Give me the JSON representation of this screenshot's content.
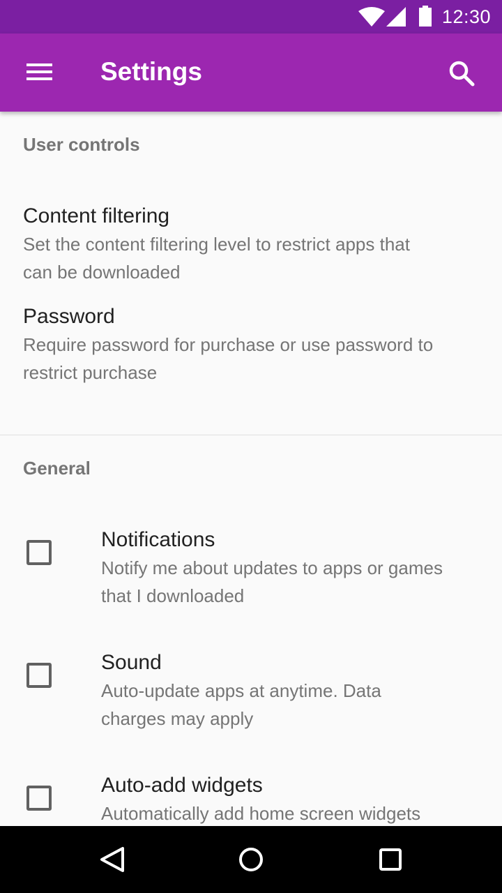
{
  "status_bar": {
    "time": "12:30",
    "icons": [
      "wifi-icon",
      "cellular-signal-icon",
      "battery-icon"
    ]
  },
  "app_bar": {
    "title": "Settings",
    "menu_icon": "menu-icon",
    "search_icon": "search-icon",
    "color": "#9c27b0",
    "status_color": "#7b1fa2"
  },
  "sections": {
    "user_controls": {
      "header": "User controls",
      "items": [
        {
          "title": "Content filtering",
          "desc_line1": "Set the content filtering level to restrict apps that",
          "desc_line2": "can be downloaded"
        },
        {
          "title": "Password",
          "desc_line1": "Require password for purchase or use password to",
          "desc_line2": "restrict purchase"
        }
      ]
    },
    "general": {
      "header": "General",
      "items": [
        {
          "title": "Notifications",
          "desc_line1": "Notify me about updates to apps or games",
          "desc_line2": "that I downloaded",
          "checked": false
        },
        {
          "title": "Sound",
          "desc_line1": "Auto-update apps at anytime. Data",
          "desc_line2": "charges may apply",
          "checked": false
        },
        {
          "title": "Auto-add widgets",
          "desc_line1": "Automatically add home screen widgets",
          "checked": false
        }
      ]
    }
  },
  "nav_bar": {
    "icons": [
      "back-icon",
      "home-icon",
      "recents-icon"
    ]
  }
}
